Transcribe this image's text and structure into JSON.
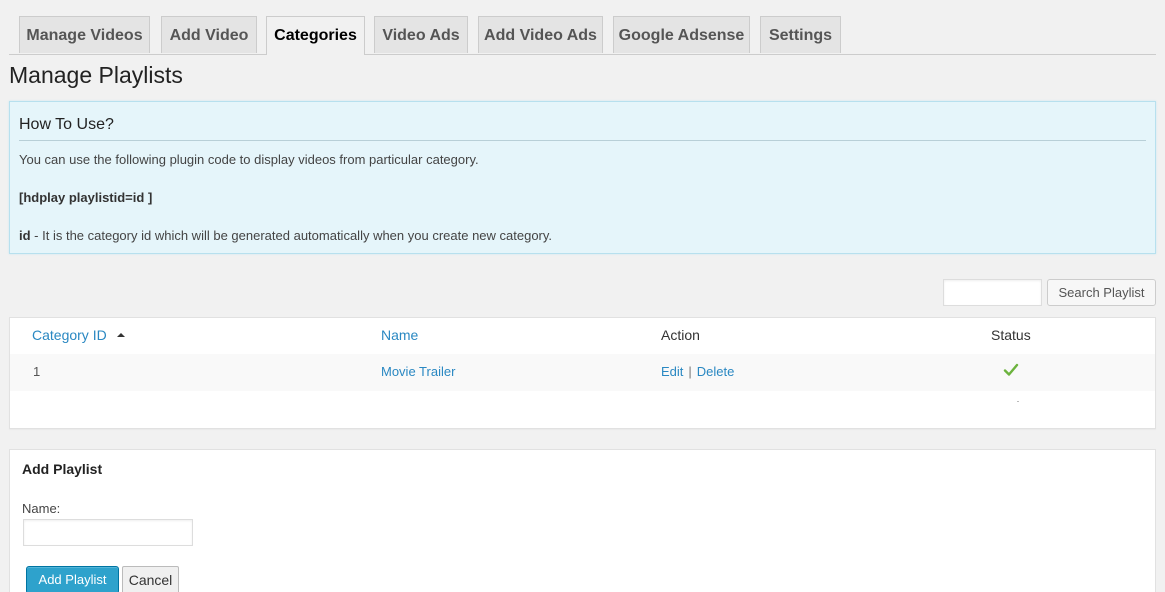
{
  "tabs": [
    {
      "label": "Manage Videos",
      "active": false
    },
    {
      "label": "Add Video",
      "active": false
    },
    {
      "label": "Categories",
      "active": true
    },
    {
      "label": "Video Ads",
      "active": false
    },
    {
      "label": "Add Video Ads",
      "active": false
    },
    {
      "label": "Google Adsense",
      "active": false
    },
    {
      "label": "Settings",
      "active": false
    }
  ],
  "page_title": "Manage Playlists",
  "info": {
    "title": "How To Use?",
    "line1": "You can use the following plugin code to display videos from particular category.",
    "code": "[hdplay playlistid=id ]",
    "id_term": "id",
    "id_desc": " - It is the category id which will be generated automatically when you create new category."
  },
  "search": {
    "input_value": "",
    "button_label": "Search Playlist"
  },
  "table": {
    "headers": {
      "category_id": "Category ID",
      "name": "Name",
      "action": "Action",
      "status": "Status"
    },
    "rows": [
      {
        "category_id": "1",
        "name": "Movie Trailer",
        "edit": "Edit",
        "separator": "|",
        "delete": "Delete",
        "status": "published"
      }
    ]
  },
  "add_playlist": {
    "title": "Add Playlist",
    "name_label": "Name:",
    "name_value": "",
    "submit_label": "Add Playlist",
    "cancel_label": "Cancel"
  },
  "colors": {
    "link": "#2a88c2",
    "primary_button": "#2ea2cc",
    "info_bg": "#e5f5fa",
    "status_check": "#6cb33e"
  },
  "icons": {
    "sort": "sort-ascending-icon",
    "status": "checkmark-icon"
  }
}
